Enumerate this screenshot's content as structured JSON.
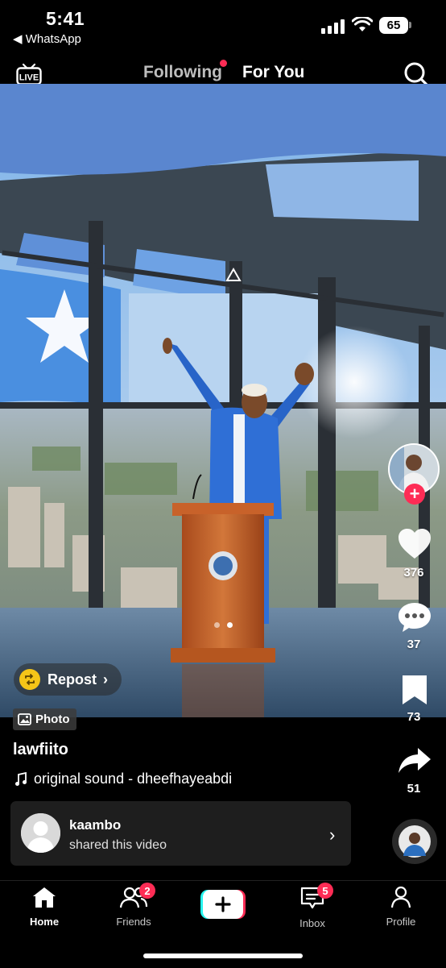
{
  "status_bar": {
    "time": "5:41",
    "back_app": "◀ WhatsApp",
    "battery": "65"
  },
  "top_nav": {
    "tabs": [
      {
        "label": "Following",
        "active": false,
        "has_dot": true
      },
      {
        "label": "For You",
        "active": true
      }
    ],
    "live_label": "LIVE"
  },
  "right_rail": {
    "likes": "376",
    "comments": "37",
    "saves": "73",
    "shares": "51"
  },
  "overlay": {
    "repost_label": "Repost",
    "photo_label": "Photo",
    "carousel_total": 2,
    "carousel_active": 2
  },
  "caption": {
    "username": "lawfiito",
    "sound": "original sound - dheefhayeabdi"
  },
  "shared_by": {
    "name": "kaambo",
    "subtitle": "shared this video"
  },
  "bottom_nav": {
    "items": [
      {
        "label": "Home",
        "active": true
      },
      {
        "label": "Friends",
        "badge": "2"
      },
      {
        "label": "Inbox",
        "badge": "5"
      },
      {
        "label": "Profile"
      }
    ]
  },
  "colors": {
    "accent": "#fe2c55",
    "repost": "#f5c518"
  }
}
